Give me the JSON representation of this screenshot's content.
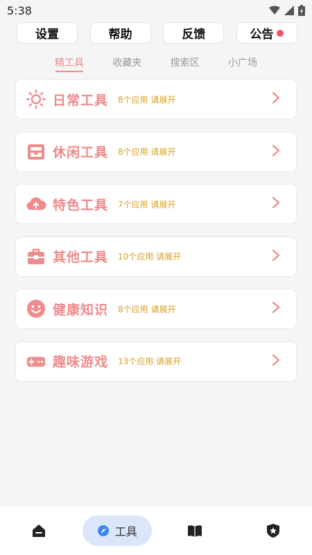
{
  "status_bar": {
    "time": "5:38"
  },
  "top_buttons": [
    {
      "label": "设置"
    },
    {
      "label": "帮助"
    },
    {
      "label": "反馈"
    },
    {
      "label": "公告",
      "has_dot": true
    }
  ],
  "tabs": [
    {
      "label": "精工具",
      "active": true
    },
    {
      "label": "收藏夹"
    },
    {
      "label": "搜索区"
    },
    {
      "label": "小广场"
    }
  ],
  "categories": [
    {
      "icon": "sun-icon",
      "title": "日常工具",
      "meta": "8个应用 请展开"
    },
    {
      "icon": "inbox-icon",
      "title": "休闲工具",
      "meta": "8个应用 请展开"
    },
    {
      "icon": "cloud-upload-icon",
      "title": "特色工具",
      "meta": "7个应用 请展开"
    },
    {
      "icon": "toolbox-icon",
      "title": "其他工具",
      "meta": "10个应用 请展开"
    },
    {
      "icon": "smiley-icon",
      "title": "健康知识",
      "meta": "8个应用 请展开"
    },
    {
      "icon": "gamepad-icon",
      "title": "趣味游戏",
      "meta": "13个应用 请展开"
    }
  ],
  "bottom_nav": {
    "items": [
      {
        "icon": "home-icon"
      },
      {
        "icon": "compass-icon",
        "label": "工具",
        "active": true
      },
      {
        "icon": "book-icon"
      },
      {
        "icon": "shield-star-icon"
      }
    ]
  },
  "colors": {
    "accent": "#ef8b8b",
    "meta": "#d9a224",
    "badge": "#f0566a",
    "nav_active": "#dbe6fb"
  }
}
